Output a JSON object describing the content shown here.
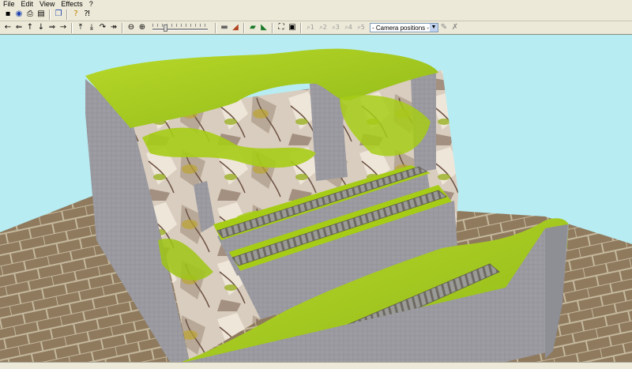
{
  "menu": {
    "file": "File",
    "edit": "Edit",
    "view": "View",
    "effects": "Effects",
    "help": "?"
  },
  "toolbar1": {
    "icons": [
      "save-icon",
      "camera-icon",
      "print-icon",
      "print-preview-icon",
      "copy-icon",
      "help-icon",
      "context-help-icon"
    ]
  },
  "toolbar2": {
    "nav_icons": [
      "arrow-left-icon",
      "arrow-left-hand-icon",
      "arrow-up-icon",
      "arrow-down-icon",
      "arrow-right-hand-icon",
      "arrow-right-icon"
    ],
    "fly_icons": [
      "fly-up-icon",
      "fly-down-icon",
      "fly-curve-icon",
      "fly-forward-icon"
    ],
    "zoom_icons": [
      "zoom-out-icon",
      "zoom-in-icon"
    ],
    "zoom_level": 0.22,
    "tool_icons": [
      "rail-icon",
      "tunnel-icon",
      "train-icon",
      "grass-icon"
    ],
    "view_icons": [
      "fit-view-icon",
      "screenshot-icon"
    ],
    "camera_slots": [
      "1",
      "2",
      "3",
      "4",
      "5"
    ],
    "camera_select": "- Camera positions -",
    "camera_tool_icons": [
      "camera-edit-icon",
      "camera-delete-icon"
    ]
  },
  "colors": {
    "sky": "#b7ecf2",
    "ground": "#8f7a5e",
    "grass": "#a8cc1a",
    "wall": "#9c9ca2",
    "track": "#8f8f8f"
  }
}
